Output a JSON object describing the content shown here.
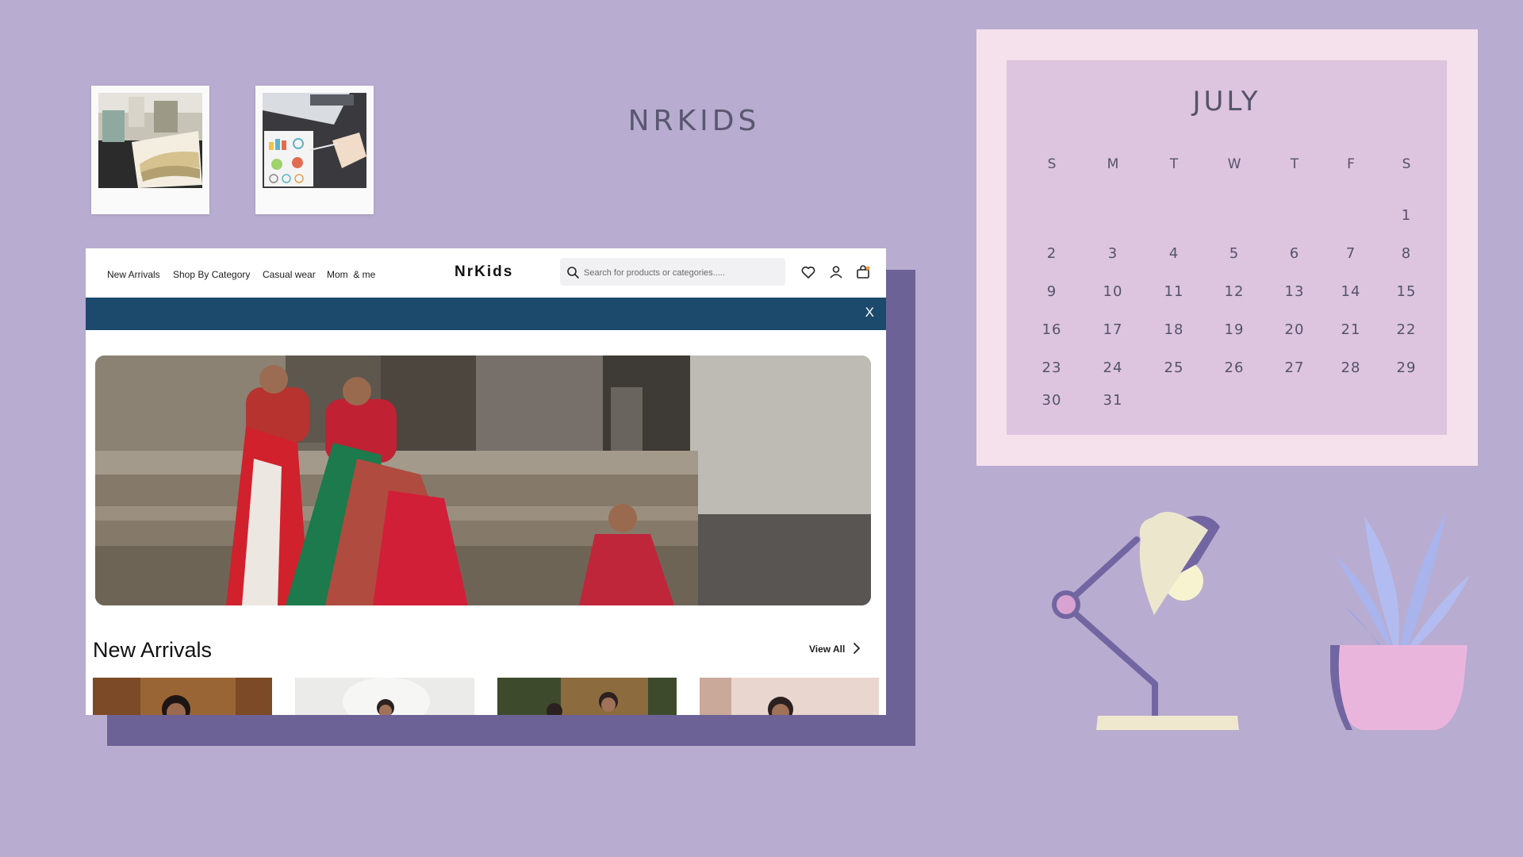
{
  "heading": "NRKIDS",
  "site": {
    "nav_links": [
      "New Arrivals",
      "Shop By Category",
      "Casual wear",
      "Mom  & me"
    ],
    "logo": "NrKids",
    "search_placeholder": "Search for products or categories.....",
    "close_label": "X",
    "section_title": "New Arrivals",
    "view_all": "View All"
  },
  "calendar": {
    "month": "JULY",
    "weekdays": [
      "S",
      "M",
      "T",
      "W",
      "T",
      "F",
      "S"
    ],
    "weeks": [
      [
        "",
        "",
        "",
        "",
        "",
        "",
        "1"
      ],
      [
        "2",
        "3",
        "4",
        "5",
        "6",
        "7",
        "8"
      ],
      [
        "9",
        "10",
        "11",
        "12",
        "13",
        "14",
        "15"
      ],
      [
        "16",
        "17",
        "18",
        "19",
        "20",
        "21",
        "22"
      ],
      [
        "23",
        "24",
        "25",
        "26",
        "27",
        "28",
        "29"
      ],
      [
        "30",
        "31",
        "",
        "",
        "",
        "",
        ""
      ]
    ]
  },
  "colors": {
    "background": "#b8acd0",
    "shadow_block": "#6c6296",
    "promo_bar": "#1c4a6c",
    "calendar_outer": "#f4e1ec",
    "calendar_inner": "#ddc4df",
    "text_dark": "#545468"
  },
  "icons": [
    "search-icon",
    "heart-icon",
    "user-icon",
    "cart-icon",
    "chevron-right-icon"
  ]
}
